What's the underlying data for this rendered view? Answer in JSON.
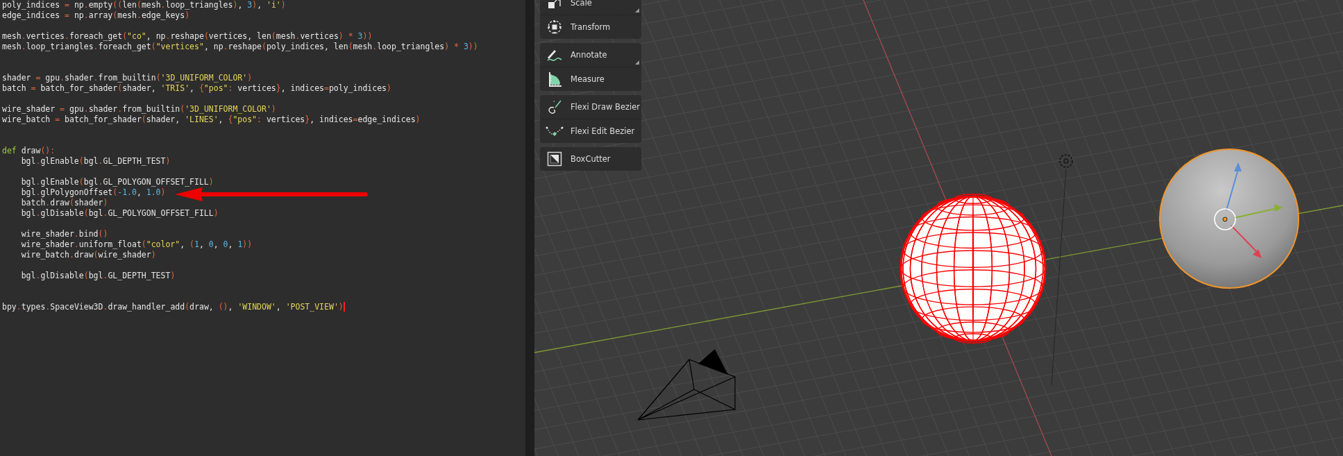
{
  "editor": {
    "lines": [
      {
        "kind": "code",
        "text": "poly_indices = np.empty((len(mesh.loop_triangles), 3), 'i')",
        "cursor": false
      },
      {
        "kind": "code",
        "text": "edge_indices = np.array(mesh.edge_keys)",
        "cursor": false
      },
      {
        "kind": "blank"
      },
      {
        "kind": "code",
        "text": "mesh.vertices.foreach_get(\"co\", np.reshape(vertices, len(mesh.vertices) * 3))",
        "cursor": false
      },
      {
        "kind": "code",
        "text": "mesh.loop_triangles.foreach_get(\"vertices\", np.reshape(poly_indices, len(mesh.loop_triangles) * 3))",
        "cursor": false
      },
      {
        "kind": "blank"
      },
      {
        "kind": "blank"
      },
      {
        "kind": "code",
        "text": "shader = gpu.shader.from_builtin('3D_UNIFORM_COLOR')",
        "cursor": false
      },
      {
        "kind": "code",
        "text": "batch = batch_for_shader(shader, 'TRIS', {\"pos\": vertices}, indices=poly_indices)",
        "cursor": false
      },
      {
        "kind": "blank"
      },
      {
        "kind": "code",
        "text": "wire_shader = gpu.shader.from_builtin('3D_UNIFORM_COLOR')",
        "cursor": false
      },
      {
        "kind": "code",
        "text": "wire_batch = batch_for_shader(shader, 'LINES', {\"pos\": vertices}, indices=edge_indices)",
        "cursor": false
      },
      {
        "kind": "blank"
      },
      {
        "kind": "blank"
      },
      {
        "kind": "def",
        "text": "def draw():",
        "cursor": false
      },
      {
        "kind": "code",
        "text": "    bgl.glEnable(bgl.GL_DEPTH_TEST)",
        "cursor": false
      },
      {
        "kind": "blank"
      },
      {
        "kind": "code",
        "text": "    bgl.glEnable(bgl.GL_POLYGON_OFFSET_FILL)",
        "cursor": false
      },
      {
        "kind": "code",
        "text": "    bgl.glPolygonOffset(-1.0, 1.0)",
        "cursor": false
      },
      {
        "kind": "code",
        "text": "    batch.draw(shader)",
        "cursor": false
      },
      {
        "kind": "code",
        "text": "    bgl.glDisable(bgl.GL_POLYGON_OFFSET_FILL)",
        "cursor": false
      },
      {
        "kind": "blank"
      },
      {
        "kind": "code",
        "text": "    wire_shader.bind()",
        "cursor": false
      },
      {
        "kind": "code",
        "text": "    wire_shader.uniform_float(\"color\", (1, 0, 0, 1))",
        "cursor": false
      },
      {
        "kind": "code",
        "text": "    wire_batch.draw(wire_shader)",
        "cursor": false
      },
      {
        "kind": "blank"
      },
      {
        "kind": "code",
        "text": "    bgl.glDisable(bgl.GL_DEPTH_TEST)",
        "cursor": false
      },
      {
        "kind": "blank"
      },
      {
        "kind": "blank"
      },
      {
        "kind": "code",
        "text": "bpy.types.SpaceView3D.draw_handler_add(draw, (), 'WINDOW', 'POST_VIEW')",
        "cursor": true
      }
    ]
  },
  "toolbar": {
    "groups": [
      {
        "items": [
          {
            "label": "Scale",
            "submenu": true
          },
          {
            "label": "Transform",
            "submenu": false
          }
        ]
      },
      {
        "items": [
          {
            "label": "Annotate",
            "submenu": true
          },
          {
            "label": "Measure",
            "submenu": false
          }
        ]
      },
      {
        "items": [
          {
            "label": "Flexi Draw Bezier",
            "submenu": false
          },
          {
            "label": "Flexi Edit Bezier",
            "submenu": false
          }
        ]
      },
      {
        "items": [
          {
            "label": "BoxCutter",
            "submenu": false
          }
        ]
      }
    ]
  }
}
